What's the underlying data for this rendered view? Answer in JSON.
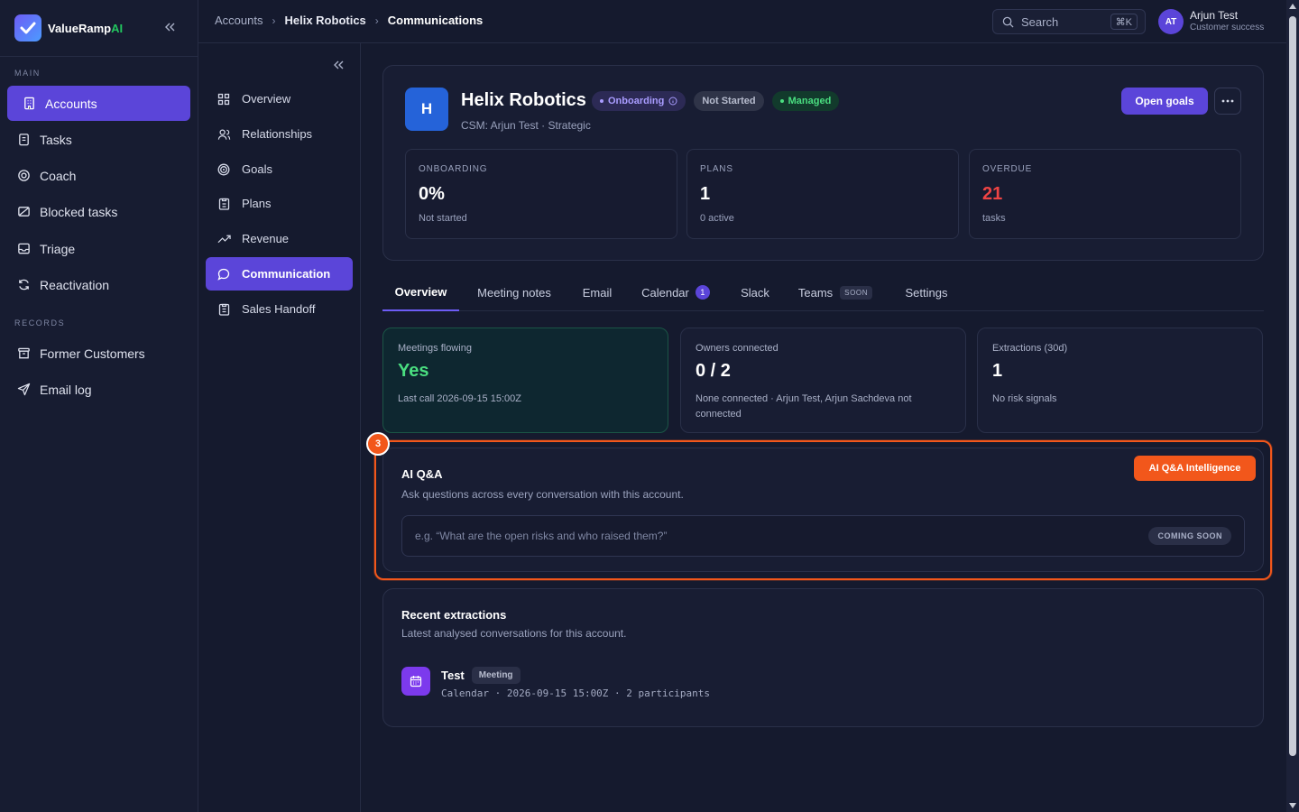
{
  "brand": {
    "name": "ValueRamp",
    "suffix": "AI"
  },
  "sidebar": {
    "sections": {
      "main": "MAIN",
      "records": "RECORDS"
    },
    "items": [
      {
        "label": "Accounts",
        "icon": "building-icon",
        "active": true
      },
      {
        "label": "Tasks",
        "icon": "clipboard-icon"
      },
      {
        "label": "Coach",
        "icon": "target-icon"
      },
      {
        "label": "Blocked tasks",
        "icon": "blocked-icon"
      },
      {
        "label": "Triage",
        "icon": "inbox-icon"
      },
      {
        "label": "Reactivation",
        "icon": "refresh-icon"
      }
    ],
    "records": [
      {
        "label": "Former Customers",
        "icon": "archive-icon"
      },
      {
        "label": "Email log",
        "icon": "send-icon"
      }
    ]
  },
  "subnav": {
    "items": [
      {
        "label": "Overview",
        "icon": "grid-icon"
      },
      {
        "label": "Relationships",
        "icon": "users-icon"
      },
      {
        "label": "Goals",
        "icon": "goal-icon"
      },
      {
        "label": "Plans",
        "icon": "clipboard-list-icon"
      },
      {
        "label": "Revenue",
        "icon": "trend-icon"
      },
      {
        "label": "Communication",
        "icon": "chat-icon",
        "active": true
      },
      {
        "label": "Sales Handoff",
        "icon": "handoff-icon"
      }
    ]
  },
  "topbar": {
    "breadcrumb": [
      "Accounts",
      "Helix Robotics",
      "Communications"
    ],
    "search": {
      "placeholder": "Search",
      "shortcut": "⌘K"
    },
    "user": {
      "initials": "AT",
      "name": "Arjun Test",
      "role": "Customer success"
    }
  },
  "account": {
    "initial": "H",
    "name": "Helix Robotics",
    "badges": {
      "onboarding": "Onboarding",
      "status": "Not Started",
      "managed": "Managed"
    },
    "subtitle": "CSM: Arjun Test · Strategic",
    "open_goals": "Open goals",
    "stats": [
      {
        "label": "ONBOARDING",
        "value": "0%",
        "sub": "Not started"
      },
      {
        "label": "PLANS",
        "value": "1",
        "sub": "0 active"
      },
      {
        "label": "OVERDUE",
        "value": "21",
        "sub": "tasks"
      }
    ]
  },
  "tabs": {
    "overview": "Overview",
    "meeting_notes": "Meeting notes",
    "email": "Email",
    "calendar": "Calendar",
    "calendar_count": "1",
    "slack": "Slack",
    "teams": "Teams",
    "teams_badge": "SOON",
    "settings": "Settings"
  },
  "metrics": [
    {
      "label": "Meetings flowing",
      "value": "Yes",
      "sub": "Last call 2026-09-15 15:00Z"
    },
    {
      "label": "Owners connected",
      "value": "0 / 2",
      "sub": "None connected · Arjun Test, Arjun Sachdeva not connected"
    },
    {
      "label": "Extractions (30d)",
      "value": "1",
      "sub": "No risk signals"
    }
  ],
  "qa": {
    "title": "AI Q&A",
    "description": "Ask questions across every conversation with this account.",
    "placeholder": "e.g. “What are the open risks and who raised them?”",
    "coming_soon": "COMING SOON",
    "highlight_label": "AI Q&A Intelligence",
    "step": "3"
  },
  "recent": {
    "title": "Recent extractions",
    "description": "Latest analysed conversations for this account.",
    "items": [
      {
        "name": "Test",
        "type": "Meeting",
        "meta": "Calendar · 2026-09-15 15:00Z · 2 participants"
      }
    ]
  },
  "colors": {
    "accent": "#5b45d9",
    "highlight": "#f2571b",
    "success": "#4ade80",
    "danger": "#ef4444",
    "background": "#151a2e"
  }
}
